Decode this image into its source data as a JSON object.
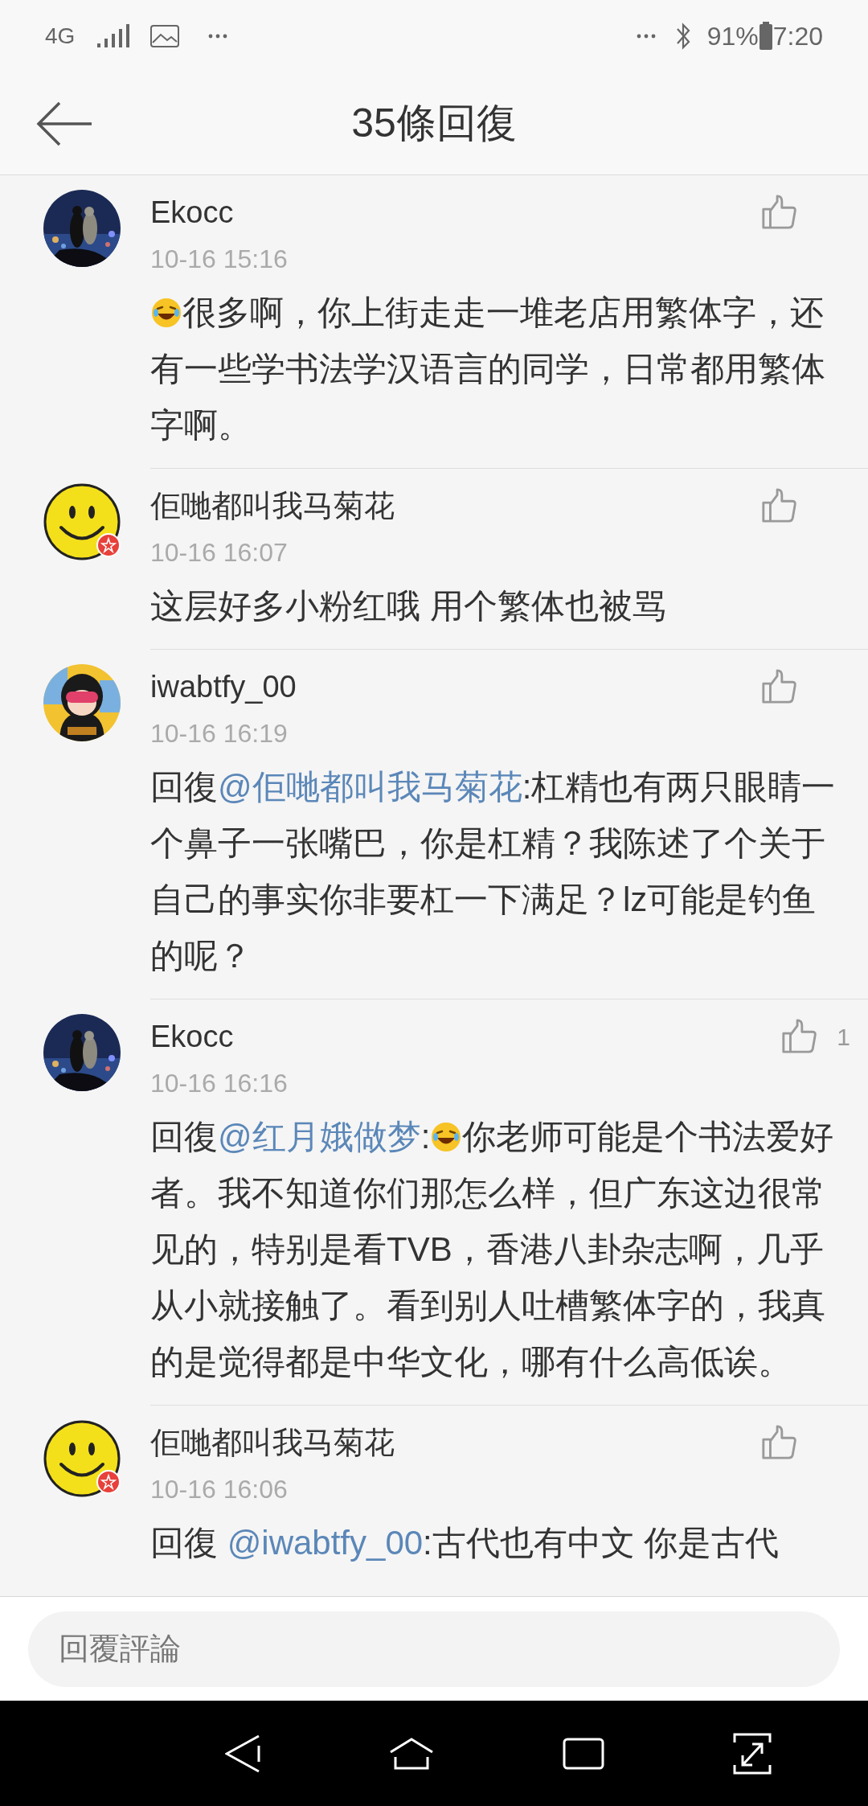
{
  "status_bar": {
    "network": "4G",
    "time": "7:20",
    "battery": "91%"
  },
  "header": {
    "title": "35條回復"
  },
  "comments": [
    {
      "name": "Ekocc",
      "date": "10-16 15:16",
      "avatar": {
        "kind": "night-photo",
        "badge": false
      },
      "body": [
        {
          "kind": "emoji"
        },
        {
          "kind": "text",
          "text": "很多啊，你上街走走一堆老店用繁体字，还有一些学书法学汉语言的同学，日常都用繁体字啊。"
        }
      ]
    },
    {
      "name": "佢哋都叫我马菊花",
      "date": "10-16 16:07",
      "avatar": {
        "kind": "smiley",
        "badge": true
      },
      "body": [
        {
          "kind": "text",
          "text": "这层好多小粉红哦 用个繁体也被骂"
        }
      ]
    },
    {
      "name": "iwabtfy_00",
      "date": "10-16 16:19",
      "avatar": {
        "kind": "cartoon",
        "badge": false
      },
      "body": [
        {
          "kind": "text",
          "text": "回復"
        },
        {
          "kind": "mention",
          "text": "@佢哋都叫我马菊花"
        },
        {
          "kind": "text",
          "text": ":杠精也有两只眼睛一个鼻子一张嘴巴，你是杠精？我陈述了个关于自己的事实你非要杠一下满足？lz可能是钓鱼的呢？"
        }
      ]
    },
    {
      "name": "Ekocc",
      "date": "10-16 16:16",
      "avatar": {
        "kind": "night-photo",
        "badge": false
      },
      "likes": "1",
      "body": [
        {
          "kind": "text",
          "text": "回復"
        },
        {
          "kind": "mention",
          "text": "@红月娥做梦"
        },
        {
          "kind": "text",
          "text": ":"
        },
        {
          "kind": "emoji"
        },
        {
          "kind": "text",
          "text": "你老师可能是个书法爱好者。我不知道你们那怎么样，但广东这边很常见的，特别是看TVB，香港八卦杂志啊，几乎从小就接触了。看到别人吐槽繁体字的，我真的是觉得都是中华文化，哪有什么高低诶。"
        }
      ]
    },
    {
      "name": "佢哋都叫我马菊花",
      "date": "10-16 16:06",
      "avatar": {
        "kind": "smiley",
        "badge": true
      },
      "body": [
        {
          "kind": "text",
          "text": "回復 "
        },
        {
          "kind": "mention",
          "text": "@iwabtfy_00"
        },
        {
          "kind": "text",
          "text": ":古代也有中文  你是古代"
        }
      ]
    }
  ],
  "reply_field": {
    "placeholder": "回覆評論"
  }
}
